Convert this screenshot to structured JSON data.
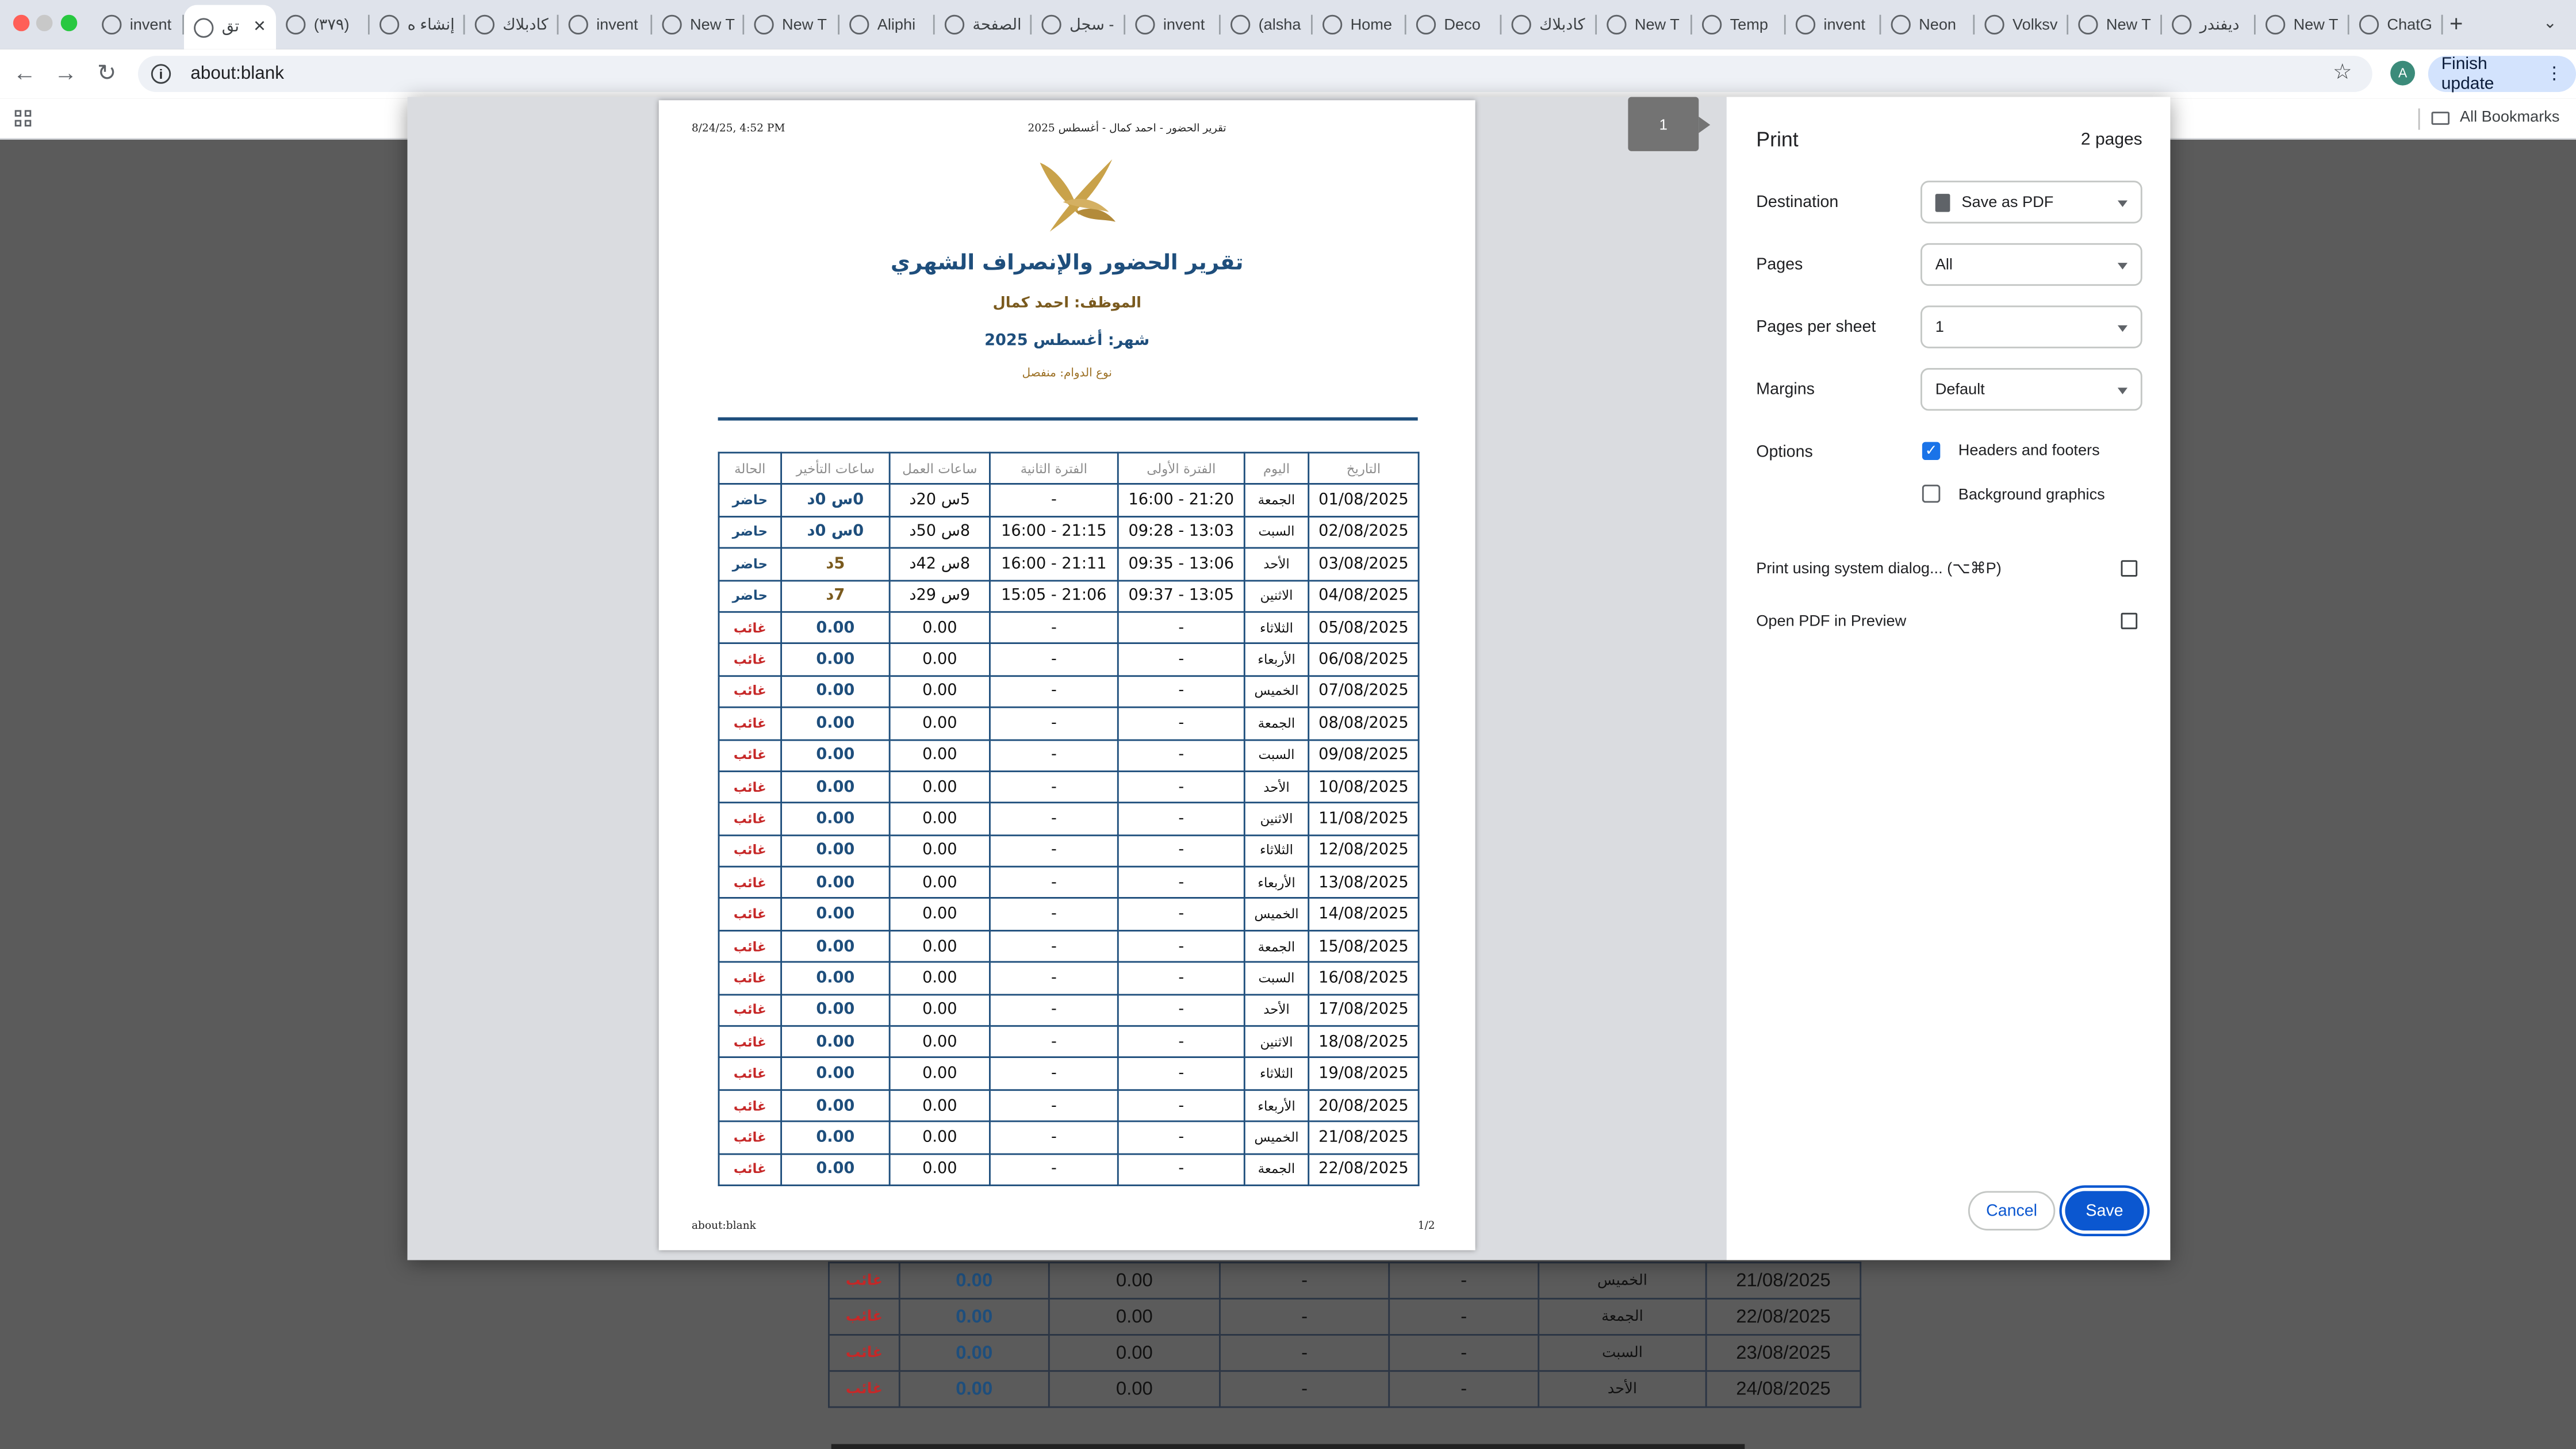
{
  "browser": {
    "tabs": [
      "invent",
      "تق",
      "(٣٧٩)",
      "إنشاء ه",
      "كادبلاك",
      "invent",
      "New T",
      "New T",
      "Aliphi",
      "الصفحة",
      "سجل -",
      "invent",
      "(alsha",
      "Home",
      "Deco",
      "كادبلاك",
      "New T",
      "Temp",
      "invent",
      "Neon",
      "Volksv",
      "New T",
      "ديفندر",
      "New T",
      "ChatG"
    ],
    "address": "about:blank",
    "finish_update": "Finish update",
    "avatar_letter": "A",
    "all_bookmarks": "All Bookmarks"
  },
  "print": {
    "title": "Print",
    "page_count": "2 pages",
    "current_page": "1",
    "destination_label": "Destination",
    "destination_value": "Save as PDF",
    "pages_label": "Pages",
    "pages_value": "All",
    "pages_per_sheet_label": "Pages per sheet",
    "pages_per_sheet_value": "1",
    "margins_label": "Margins",
    "margins_value": "Default",
    "options_label": "Options",
    "headers_footers": "Headers and footers",
    "headers_footers_checked": true,
    "background_graphics": "Background graphics",
    "background_graphics_checked": false,
    "system_dialog": "Print using system dialog... (⌥⌘P)",
    "open_preview": "Open PDF in Preview",
    "cancel": "Cancel",
    "save": "Save"
  },
  "document": {
    "header_left": "8/24/25, 4:52 PM",
    "header_center": "تقرير الحضور - احمد كمال - أغسطس 2025",
    "footer_left": "about:blank",
    "footer_right": "1/2",
    "title": "تقرير الحضور والإنصراف الشهري",
    "employee": "الموظف: احمد كمال",
    "month": "شهر: أغسطس 2025",
    "shift_type": "نوع الدوام: منفصل",
    "columns": [
      "التاريخ",
      "اليوم",
      "الفترة الأولى",
      "الفترة الثانية",
      "ساعات العمل",
      "ساعات التأخير",
      "الحالة"
    ],
    "rows": [
      [
        "01/08/2025",
        "الجمعة",
        "16:00 - 21:20",
        "-",
        "5س 20د",
        "0س 0د",
        "حاضر"
      ],
      [
        "02/08/2025",
        "السبت",
        "09:28 - 13:03",
        "16:00 - 21:15",
        "8س 50د",
        "0س 0د",
        "حاضر"
      ],
      [
        "03/08/2025",
        "الأحد",
        "09:35 - 13:06",
        "16:00 - 21:11",
        "8س 42د",
        "5د",
        "حاضر"
      ],
      [
        "04/08/2025",
        "الاثنين",
        "09:37 - 13:05",
        "15:05 - 21:06",
        "9س 29د",
        "7د",
        "حاضر"
      ],
      [
        "05/08/2025",
        "الثلاثاء",
        "-",
        "-",
        "0.00",
        "0.00",
        "غائب"
      ],
      [
        "06/08/2025",
        "الأربعاء",
        "-",
        "-",
        "0.00",
        "0.00",
        "غائب"
      ],
      [
        "07/08/2025",
        "الخميس",
        "-",
        "-",
        "0.00",
        "0.00",
        "غائب"
      ],
      [
        "08/08/2025",
        "الجمعة",
        "-",
        "-",
        "0.00",
        "0.00",
        "غائب"
      ],
      [
        "09/08/2025",
        "السبت",
        "-",
        "-",
        "0.00",
        "0.00",
        "غائب"
      ],
      [
        "10/08/2025",
        "الأحد",
        "-",
        "-",
        "0.00",
        "0.00",
        "غائب"
      ],
      [
        "11/08/2025",
        "الاثنين",
        "-",
        "-",
        "0.00",
        "0.00",
        "غائب"
      ],
      [
        "12/08/2025",
        "الثلاثاء",
        "-",
        "-",
        "0.00",
        "0.00",
        "غائب"
      ],
      [
        "13/08/2025",
        "الأربعاء",
        "-",
        "-",
        "0.00",
        "0.00",
        "غائب"
      ],
      [
        "14/08/2025",
        "الخميس",
        "-",
        "-",
        "0.00",
        "0.00",
        "غائب"
      ],
      [
        "15/08/2025",
        "الجمعة",
        "-",
        "-",
        "0.00",
        "0.00",
        "غائب"
      ],
      [
        "16/08/2025",
        "السبت",
        "-",
        "-",
        "0.00",
        "0.00",
        "غائب"
      ],
      [
        "17/08/2025",
        "الأحد",
        "-",
        "-",
        "0.00",
        "0.00",
        "غائب"
      ],
      [
        "18/08/2025",
        "الاثنين",
        "-",
        "-",
        "0.00",
        "0.00",
        "غائب"
      ],
      [
        "19/08/2025",
        "الثلاثاء",
        "-",
        "-",
        "0.00",
        "0.00",
        "غائب"
      ],
      [
        "20/08/2025",
        "الأربعاء",
        "-",
        "-",
        "0.00",
        "0.00",
        "غائب"
      ],
      [
        "21/08/2025",
        "الخميس",
        "-",
        "-",
        "0.00",
        "0.00",
        "غائب"
      ],
      [
        "22/08/2025",
        "الجمعة",
        "-",
        "-",
        "0.00",
        "0.00",
        "غائب"
      ]
    ]
  },
  "background_rows": [
    [
      "21/08/2025",
      "الخميس",
      "-",
      "-",
      "0.00",
      "0.00",
      "غائب"
    ],
    [
      "22/08/2025",
      "الجمعة",
      "-",
      "-",
      "0.00",
      "0.00",
      "غائب"
    ],
    [
      "23/08/2025",
      "السبت",
      "-",
      "-",
      "0.00",
      "0.00",
      "غائب"
    ],
    [
      "24/08/2025",
      "الأحد",
      "-",
      "-",
      "0.00",
      "0.00",
      "غائب"
    ]
  ],
  "colors": {
    "accent": "#0b57d0",
    "report_blue": "#1e4e7c",
    "gold": "#c9a24a",
    "absent_red": "#c62828"
  }
}
